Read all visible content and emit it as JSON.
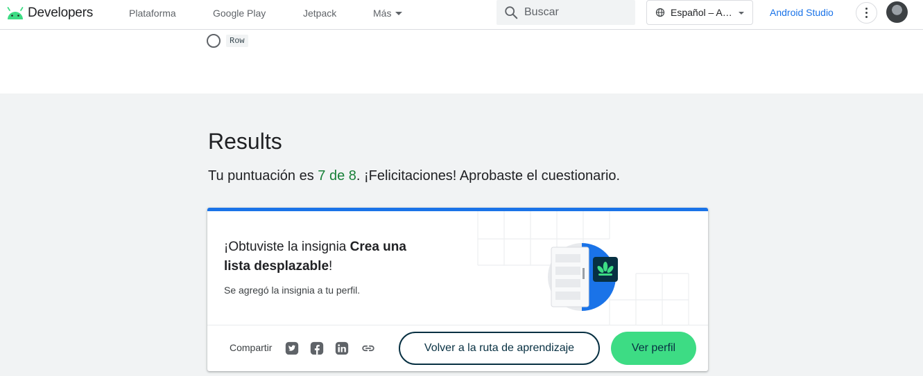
{
  "header": {
    "logo_text": "Developers",
    "nav": [
      {
        "label": "Plataforma"
      },
      {
        "label": "Google Play"
      },
      {
        "label": "Jetpack"
      },
      {
        "label": "Más"
      }
    ],
    "search_placeholder": "Buscar",
    "language": "Español – A…",
    "android_studio": "Android Studio",
    "brand_color": "#3ddc84",
    "link_color": "#1a73e8"
  },
  "quiz_option": {
    "code": "Row"
  },
  "results": {
    "title": "Results",
    "score_prefix": "Tu puntuación es ",
    "score": "7 de 8",
    "score_suffix": ". ¡Felicitaciones! Aprobaste el cuestionario.",
    "score_color": "#188038"
  },
  "badge_card": {
    "heading_prefix": "¡Obtuviste la insignia ",
    "badge_name": "Crea una lista desplazable",
    "heading_suffix": "!",
    "note": "Se agregó la insignia a tu perfil.",
    "accent_color": "#1a73e8",
    "share_label": "Compartir",
    "share_icons": [
      "twitter-icon",
      "facebook-icon",
      "linkedin-icon",
      "link-icon"
    ],
    "back_button": "Volver a la ruta de aprendizaje",
    "profile_button": "Ver perfil"
  }
}
